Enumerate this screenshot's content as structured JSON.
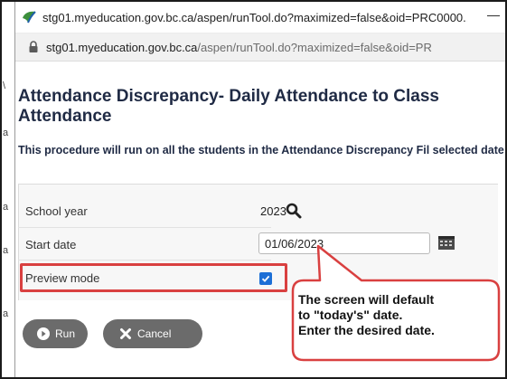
{
  "window": {
    "title": "stg01.myeducation.gov.bc.ca/aspen/runTool.do?maximized=false&oid=PRC0000...",
    "minimize_glyph": "—"
  },
  "address": {
    "host": "stg01.myeducation.gov.bc.ca",
    "path": "/aspen/runTool.do?maximized=false&oid=PR"
  },
  "page": {
    "title": "Attendance Discrepancy- Daily Attendance to Class Attendance",
    "description": "This procedure will run on all the students in the Attendance Discrepancy Fil selected date"
  },
  "form": {
    "school_year_label": "School year",
    "school_year_value": "2023",
    "start_date_label": "Start date",
    "start_date_value": "01/06/2023",
    "preview_label": "Preview mode",
    "preview_checked": true
  },
  "buttons": {
    "run": "Run",
    "cancel": "Cancel"
  },
  "callout": {
    "lines": [
      "The screen will default",
      "to \"today's\" date.",
      "Enter the desired date."
    ],
    "border_color": "#d94040"
  },
  "colors": {
    "heading": "#1f2a44",
    "button_bg": "#6b6b6b",
    "checkbox": "#1c6fd6",
    "highlight": "#d94040"
  }
}
